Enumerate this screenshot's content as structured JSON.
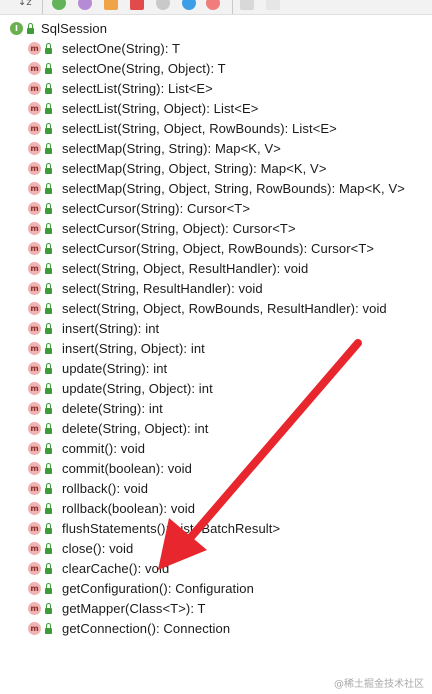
{
  "toolbar": {
    "icons": [
      "sort-alpha-icon",
      "interface-filter-icon",
      "property-filter-icon",
      "field-filter-icon",
      "lock-filter-icon",
      "circle-filter-icon",
      "lambda-filter-icon",
      "collapse-icon",
      "expand-icon"
    ],
    "sort_label": "↓z"
  },
  "tree": {
    "interface_badge": "I",
    "method_badge": "m",
    "interface_name": "SqlSession",
    "methods": [
      "selectOne(String): T",
      "selectOne(String, Object): T",
      "selectList(String): List<E>",
      "selectList(String, Object): List<E>",
      "selectList(String, Object, RowBounds): List<E>",
      "selectMap(String, String): Map<K, V>",
      "selectMap(String, Object, String): Map<K, V>",
      "selectMap(String, Object, String, RowBounds): Map<K, V>",
      "selectCursor(String): Cursor<T>",
      "selectCursor(String, Object): Cursor<T>",
      "selectCursor(String, Object, RowBounds): Cursor<T>",
      "select(String, Object, ResultHandler): void",
      "select(String, ResultHandler): void",
      "select(String, Object, RowBounds, ResultHandler): void",
      "insert(String): int",
      "insert(String, Object): int",
      "update(String): int",
      "update(String, Object): int",
      "delete(String): int",
      "delete(String, Object): int",
      "commit(): void",
      "commit(boolean): void",
      "rollback(): void",
      "rollback(boolean): void",
      "flushStatements(): List<BatchResult>",
      "close(): void",
      "clearCache(): void",
      "getConfiguration(): Configuration",
      "getMapper(Class<T>): T",
      "getConnection(): Connection"
    ]
  },
  "annotation": {
    "arrow_color": "#e8262d"
  },
  "watermark": "@稀土掘金技术社区"
}
